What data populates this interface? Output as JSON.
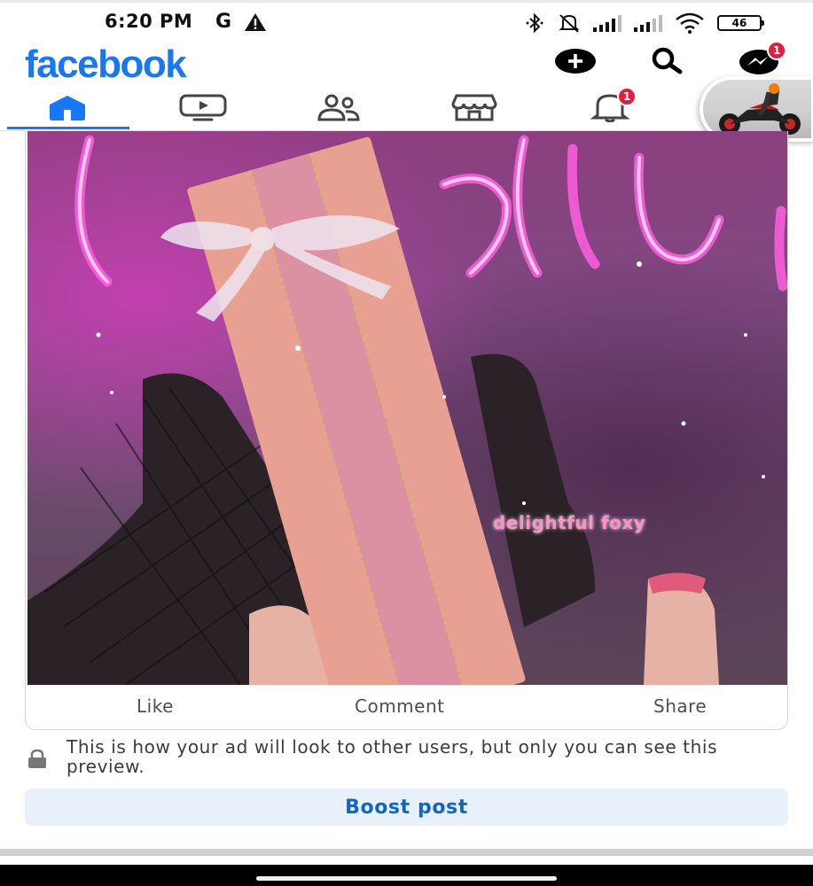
{
  "status_bar": {
    "time": "6:20 PM",
    "carrier_icon": "G",
    "battery_level": "46",
    "icons": [
      "google-icon",
      "warning-icon",
      "bluetooth-icon",
      "mute-icon",
      "signal-icon",
      "signal-icon",
      "wifi-icon",
      "battery-icon"
    ]
  },
  "header": {
    "logo": "facebook",
    "messenger_badge": "1",
    "colors": {
      "brand": "#1877f2",
      "badge": "#e41e3f"
    }
  },
  "nav": {
    "tabs": [
      "home",
      "video",
      "friends",
      "marketplace",
      "notifications",
      "profile"
    ],
    "active_tab": "home",
    "notifications_badge": "1"
  },
  "post": {
    "media_overlay_text": "delightful foxy",
    "actions": {
      "like": "Like",
      "comment": "Comment",
      "share": "Share"
    }
  },
  "notice": {
    "text": "This is how your ad will look to other users, but only you can see this preview."
  },
  "boost": {
    "label": "Boost post"
  }
}
